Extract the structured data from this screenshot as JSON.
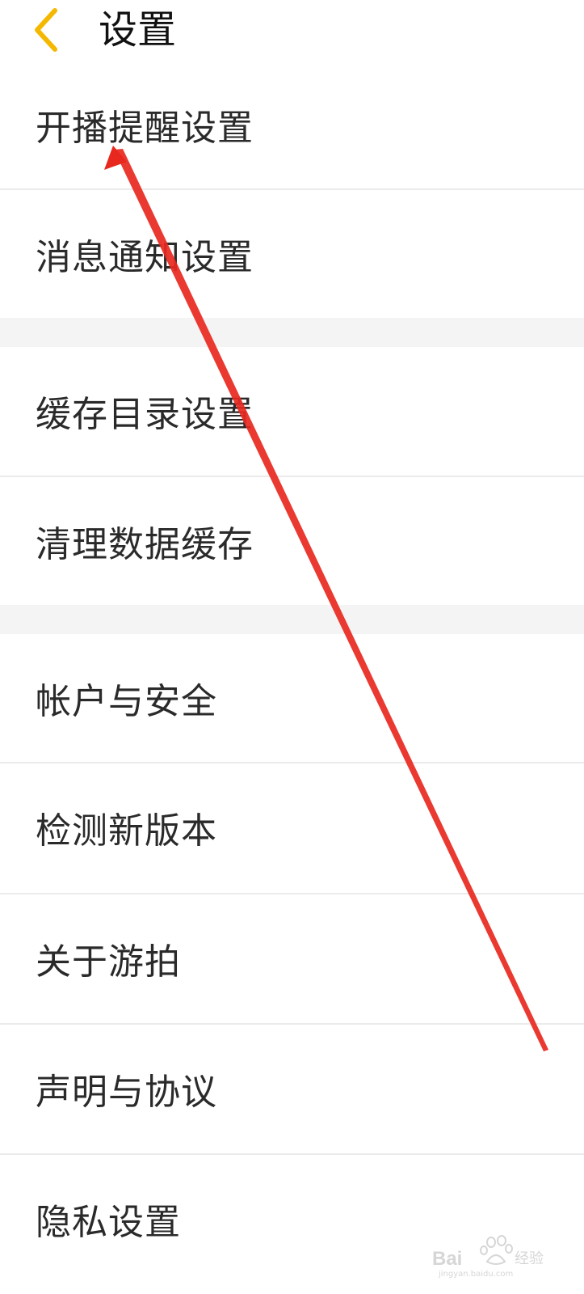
{
  "header": {
    "title": "设置",
    "back_icon": "chevron-left-icon",
    "accent_color": "#f5b800"
  },
  "groups": [
    {
      "items": [
        {
          "label": "开播提醒设置"
        },
        {
          "label": "消息通知设置"
        }
      ]
    },
    {
      "items": [
        {
          "label": "缓存目录设置"
        },
        {
          "label": "清理数据缓存"
        }
      ]
    },
    {
      "items": [
        {
          "label": "帐户与安全"
        },
        {
          "label": "检测新版本"
        },
        {
          "label": "关于游拍"
        },
        {
          "label": "声明与协议"
        },
        {
          "label": "隐私设置"
        }
      ]
    }
  ],
  "annotation": {
    "type": "red-arrow",
    "color": "#e8281e",
    "points_to": "开播提醒设置"
  },
  "watermark": {
    "logo": "Baidu经验",
    "url": "jingyan.baidu.com"
  }
}
